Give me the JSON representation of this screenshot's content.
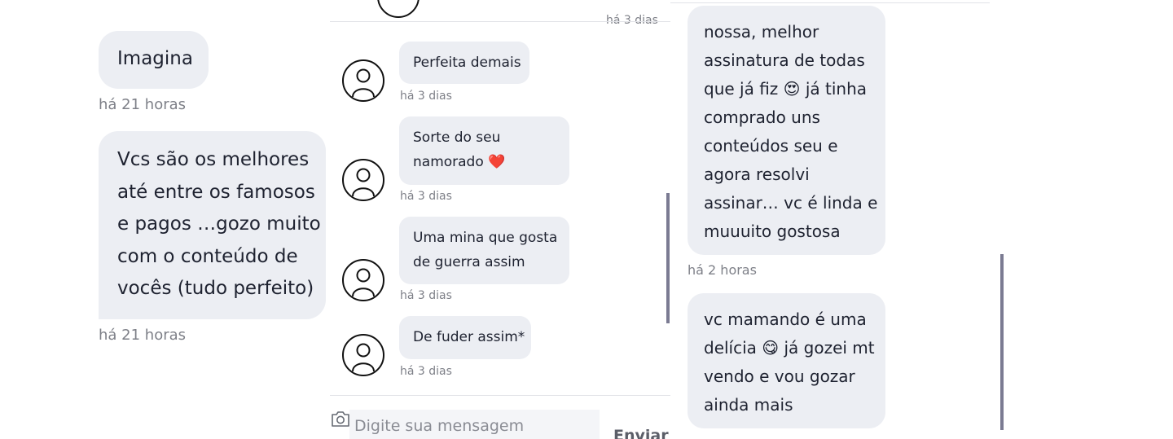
{
  "left_panel": {
    "messages": [
      {
        "text": "Imagina",
        "time": "há 21 horas"
      },
      {
        "text": "Vcs são os melhores até entre os famosos e pagos …gozo muito com o conteúdo de vocês (tudo perfeito)",
        "time": "há 21 horas"
      }
    ]
  },
  "middle_panel": {
    "top_time": "há 3 dias",
    "messages": [
      {
        "text": "Perfeita demais",
        "time": "há 3 dias"
      },
      {
        "text": "Sorte do seu namorado ❤️",
        "time": "há 3 dias"
      },
      {
        "text": "Uma mina que gosta de guerra assim",
        "time": "há 3 dias"
      },
      {
        "text": "De fuder assim*",
        "time": "há 3 dias"
      }
    ],
    "composer": {
      "placeholder": "Digite sua mensagem",
      "send_label": "Enviar"
    }
  },
  "right_panel": {
    "messages": [
      {
        "text": "nossa, melhor assinatura de todas que já fiz 😍 já tinha comprado uns conteúdos seu e agora resolvi assinar… vc é linda e muuuito gostosa",
        "time": "há 2 horas"
      },
      {
        "text": "vc mamando é uma delícia 😋 já gozei mt vendo e vou gozar ainda mais"
      }
    ]
  },
  "colors": {
    "bubble": "#eceef3",
    "timestamp": "#7e8088",
    "scrollbar": "#7b7b92"
  }
}
